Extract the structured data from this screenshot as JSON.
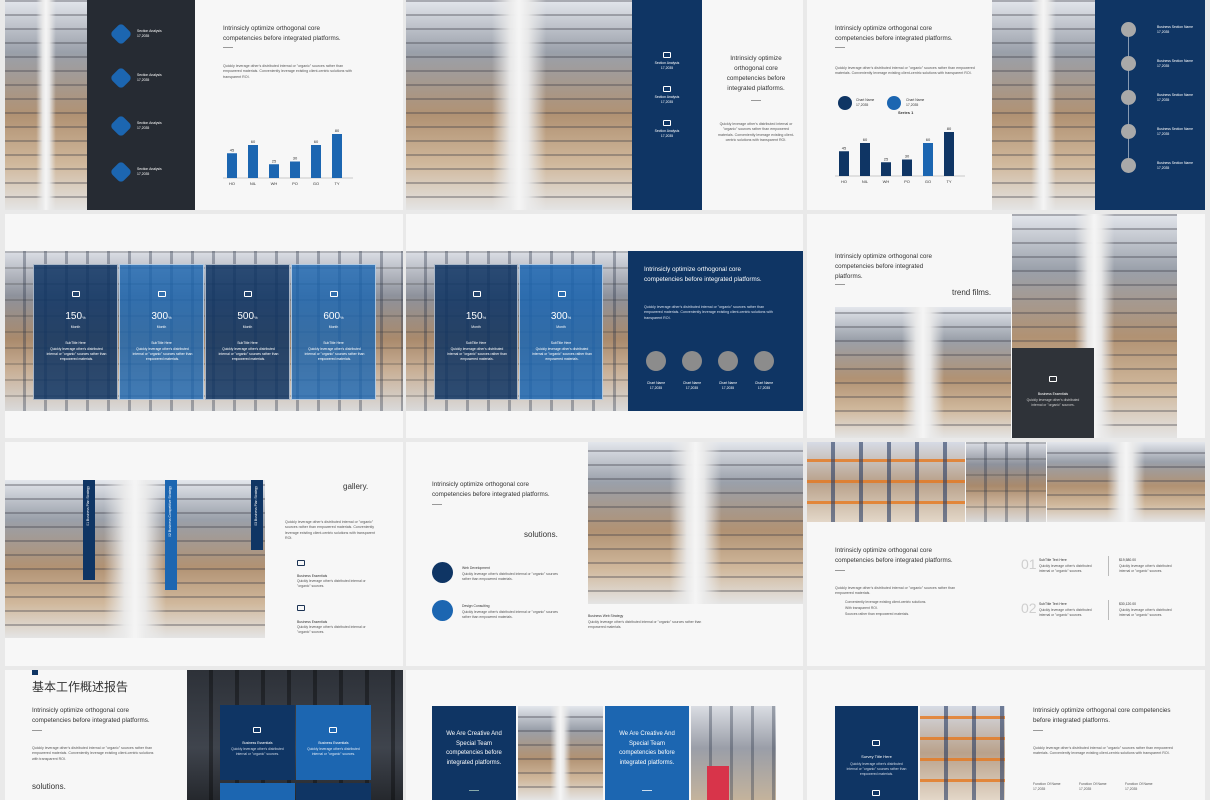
{
  "common": {
    "headline2": "Intrinsicly optimize orthogonal core competencies before integrated platforms.",
    "headline3": "Intrinsicly optimize orthogonal core competencies before integrated platforms.",
    "body": "Quickly leverage other's distributed internal or \"organic\" sources rather than empowered materials. Conveniently leverage existing client-centric solutions with transparent ROI.",
    "body_short": "Quickly leverage other's distributed internal or \"organic\" sources rather than empowered materials.",
    "section": "Section Analysis",
    "section_name": "Business Section Name",
    "date": "17,2035"
  },
  "s1": {
    "items": [
      {
        "label": "Section Analysis",
        "date": "17,2035"
      },
      {
        "label": "Section Analysis",
        "date": "17,2035"
      },
      {
        "label": "Section Analysis",
        "date": "17,2035"
      },
      {
        "label": "Section Analysis",
        "date": "17,2035"
      }
    ]
  },
  "chart_data": [
    {
      "type": "bar",
      "categories": [
        "HO",
        "NIL",
        "WH",
        "PO",
        "GO",
        "TY"
      ],
      "values": [
        45,
        60,
        25,
        30,
        60,
        80
      ],
      "title": "",
      "xlabel": "",
      "ylabel": ""
    },
    {
      "type": "bar",
      "categories": [
        "HO",
        "NIL",
        "WH",
        "PO",
        "GO",
        "TY"
      ],
      "values": [
        45,
        60,
        25,
        30,
        60,
        80
      ],
      "title": "Series 1",
      "xlabel": "",
      "ylabel": "",
      "legend": [
        "Chart Name",
        "Chart Name"
      ]
    }
  ],
  "s3": {
    "legend1": "Chart Name",
    "legend2": "Chart Name",
    "legend_date": "17,2035",
    "series": "Series 1"
  },
  "s4": {
    "cards": [
      {
        "num": "150",
        "unit": "%",
        "sub": "Month",
        "title": "SubTitle Here"
      },
      {
        "num": "300",
        "unit": "%",
        "sub": "Month",
        "title": "SubTitle Here"
      },
      {
        "num": "500",
        "unit": "%",
        "sub": "Month",
        "title": "SubTitle Here"
      },
      {
        "num": "600",
        "unit": "%",
        "sub": "Month",
        "title": "SubTitle Here"
      }
    ]
  },
  "s5": {
    "chart_name": "Chart Name"
  },
  "s6": {
    "headline": "Intrinsicly optimize orthogonal core competencies before integrated platforms.",
    "keyword": "trend films.",
    "box_title": "Business Essentials",
    "box_body": "Quickly leverage other's distributed internal or \"organic\" sources."
  },
  "s7": {
    "keyword": "gallery.",
    "v1": "01 Business Plan Strategy",
    "v2": "02 Business Competitive Strategy",
    "v3": "03 Business Plan Strategy",
    "item1": "Business Essentials",
    "item2": "Business Essentials",
    "item_body": "Quickly leverage other's distributed internal or \"organic\" sources."
  },
  "s8": {
    "keyword": "solutions.",
    "item1": "Web Development",
    "item2": "Design Consulting",
    "item_body": "Quickly leverage other's distributed internal or \"organic\" sources rather than empowered materials.",
    "caption_title": "Business Web Strategy",
    "caption_body": "Quickly leverage other's distributed internal or \"organic\" sources rather than empowered materials."
  },
  "s9": {
    "n1": "01",
    "n2": "02",
    "t1": "SubTitle Text Here",
    "t2": "SubTitle Text Here",
    "v1": "$19,580.00",
    "v2": "$30,120.00",
    "v_body": "Quickly leverage other's distributed internal or \"organic\" sources.",
    "bullets": [
      "Conveniently leverage existing client-centric solutions.",
      "With transparent ROI.",
      "Sources rather than empowered materials."
    ]
  },
  "s10": {
    "title": "基本工作概述报告",
    "keyword": "solutions.",
    "card": "Business Essentials"
  },
  "s11": {
    "card": "We Are Creative And Special Team competencies before integrated platforms."
  },
  "s12": {
    "card": "Survey Title Here",
    "f1": "Function Of Name",
    "f2": "Function Of Name",
    "f3": "Function Of Name"
  }
}
